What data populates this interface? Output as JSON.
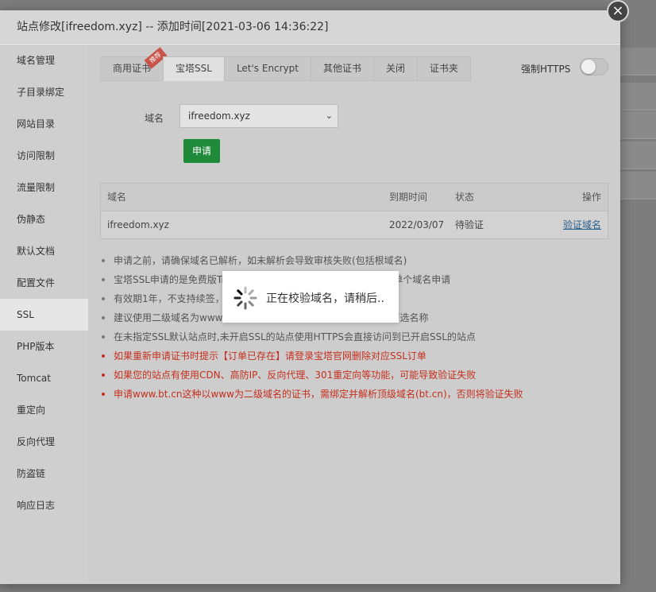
{
  "modal": {
    "title": "站点修改[ifreedom.xyz] -- 添加时间[2021-03-06 14:36:22]",
    "close_symbol": "×"
  },
  "sidebar": {
    "items": [
      {
        "label": "域名管理"
      },
      {
        "label": "子目录绑定"
      },
      {
        "label": "网站目录"
      },
      {
        "label": "访问限制"
      },
      {
        "label": "流量限制"
      },
      {
        "label": "伪静态"
      },
      {
        "label": "默认文档"
      },
      {
        "label": "配置文件"
      },
      {
        "label": "SSL",
        "active": true
      },
      {
        "label": "PHP版本"
      },
      {
        "label": "Tomcat"
      },
      {
        "label": "重定向"
      },
      {
        "label": "反向代理"
      },
      {
        "label": "防盗链"
      },
      {
        "label": "响应日志"
      }
    ]
  },
  "tabs": {
    "items": [
      {
        "label": "商用证书",
        "badge": "推荐"
      },
      {
        "label": "宝塔SSL",
        "active": true
      },
      {
        "label": "Let's Encrypt"
      },
      {
        "label": "其他证书"
      },
      {
        "label": "关闭"
      },
      {
        "label": "证书夹"
      }
    ]
  },
  "https_toggle": {
    "label": "强制HTTPS",
    "on": false
  },
  "form": {
    "domain_label": "域名",
    "domain_value": "ifreedom.xyz",
    "apply_label": "申请"
  },
  "table": {
    "headers": [
      "域名",
      "到期时间",
      "状态",
      "操作"
    ],
    "rows": [
      {
        "domain": "ifreedom.xyz",
        "expiry": "2022/03/07",
        "status": "待验证",
        "action": "验证域名"
      }
    ]
  },
  "notes": [
    {
      "text": "申请之前，请确保域名已解析，如未解析会导致审核失败(包括根域名)",
      "color": "normal"
    },
    {
      "text": "宝塔SSL申请的是免费版TrustAsia DV SSL CA - G5证书，仅支持单个域名申请",
      "color": "normal"
    },
    {
      "text": "有效期1年，不支持续签，",
      "color": "normal"
    },
    {
      "text": "建议使用二级域名为www",
      "text_tail": "域名为可选名称",
      "color": "normal"
    },
    {
      "text": "在未指定SSL默认站点时,未开启SSL的站点使用HTTPS会直接访问到已开启SSL的站点",
      "color": "normal"
    },
    {
      "text": "如果重新申请证书时提示【订单已存在】请登录宝塔官网删除对应SSL订单",
      "color": "red"
    },
    {
      "text": "如果您的站点有使用CDN、高防IP、反向代理、301重定向等功能，可能导致验证失败",
      "color": "red"
    },
    {
      "text": "申请www.bt.cn这种以www为二级域名的证书，需绑定并解析顶级域名(bt.cn)，否则将验证失败",
      "color": "red"
    }
  ],
  "loading": {
    "text": "正在校验域名，请稍后.."
  },
  "colors": {
    "apply_button": "#1f8a3a",
    "warning_text": "#c62f1d",
    "link": "#2b5e8a"
  }
}
